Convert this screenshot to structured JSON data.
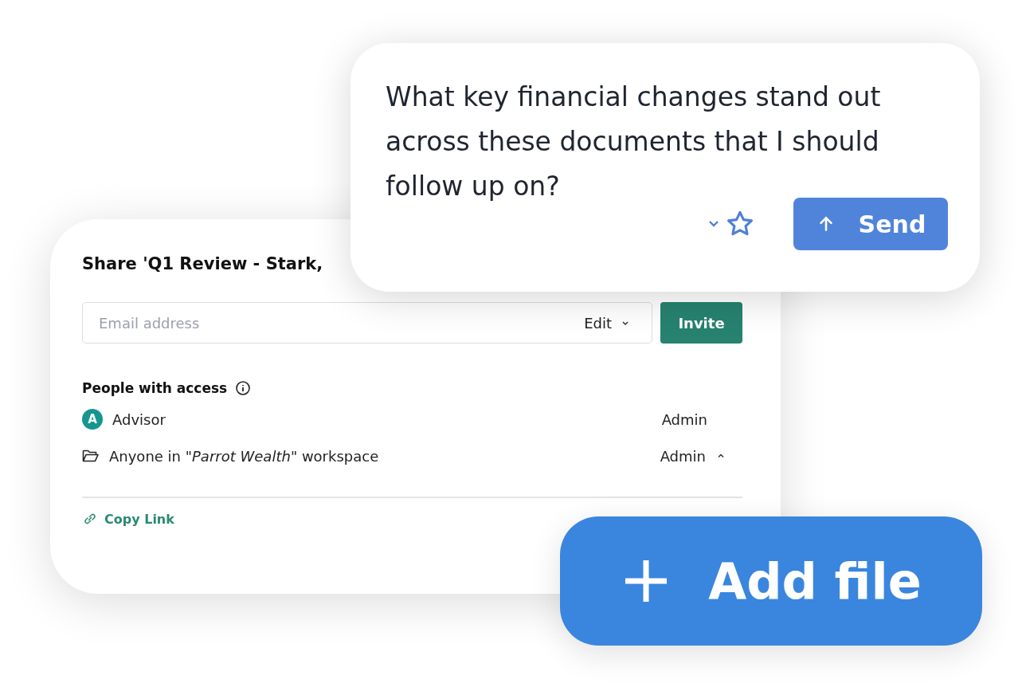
{
  "share_dialog": {
    "title": "Share 'Q1 Review - Stark,",
    "email_field": {
      "placeholder": "Email address",
      "permission": "Edit"
    },
    "invite_button": "Invite",
    "access_heading": "People with access",
    "members": [
      {
        "kind": "person",
        "avatar": "A",
        "name": "Advisor",
        "role": "Admin"
      },
      {
        "kind": "workspace",
        "name": "Anyone in \"*Parrot Wealth*\" workspace",
        "role": "Admin",
        "expanded": true
      }
    ],
    "copy_link": "Copy Link"
  },
  "chat_prompt": {
    "text": "What key financial changes stand out across these documents that I should follow up on?",
    "send_button": "Send"
  },
  "add_file_button": "Add file"
}
